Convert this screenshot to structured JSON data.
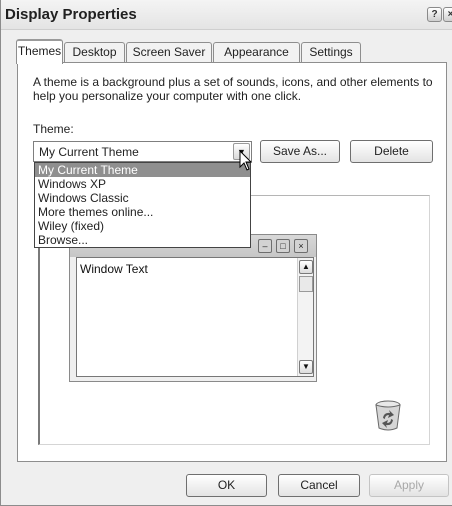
{
  "window": {
    "title": "Display Properties",
    "help_glyph": "?",
    "close_glyph": "×"
  },
  "tabs": [
    {
      "label": "Themes",
      "active": true
    },
    {
      "label": "Desktop"
    },
    {
      "label": "Screen Saver"
    },
    {
      "label": "Appearance"
    },
    {
      "label": "Settings"
    }
  ],
  "themes_tab": {
    "description": "A theme is a background plus a set of sounds, icons, and other elements to help you personalize your computer with one click.",
    "theme_label": "Theme:",
    "selected_theme": "My Current Theme",
    "save_as_label": "Save As...",
    "delete_label": "Delete",
    "dropdown_options": [
      "My Current Theme",
      "Windows XP",
      "Windows Classic",
      "More themes online...",
      "Wiley (fixed)",
      "Browse..."
    ],
    "sample": {
      "window_text": "Window Text"
    }
  },
  "footer": {
    "ok_label": "OK",
    "cancel_label": "Cancel",
    "apply_label": "Apply"
  },
  "colors": {
    "selection_highlight": "#8f8f8f",
    "disabled_text": "#a8a8a8"
  },
  "icons": [
    "help-icon",
    "close-icon",
    "chevron-down-icon",
    "mouse-cursor-icon",
    "minimize-icon",
    "maximize-icon",
    "close-icon",
    "scroll-up-icon",
    "scroll-down-icon",
    "recycle-bin-icon"
  ]
}
